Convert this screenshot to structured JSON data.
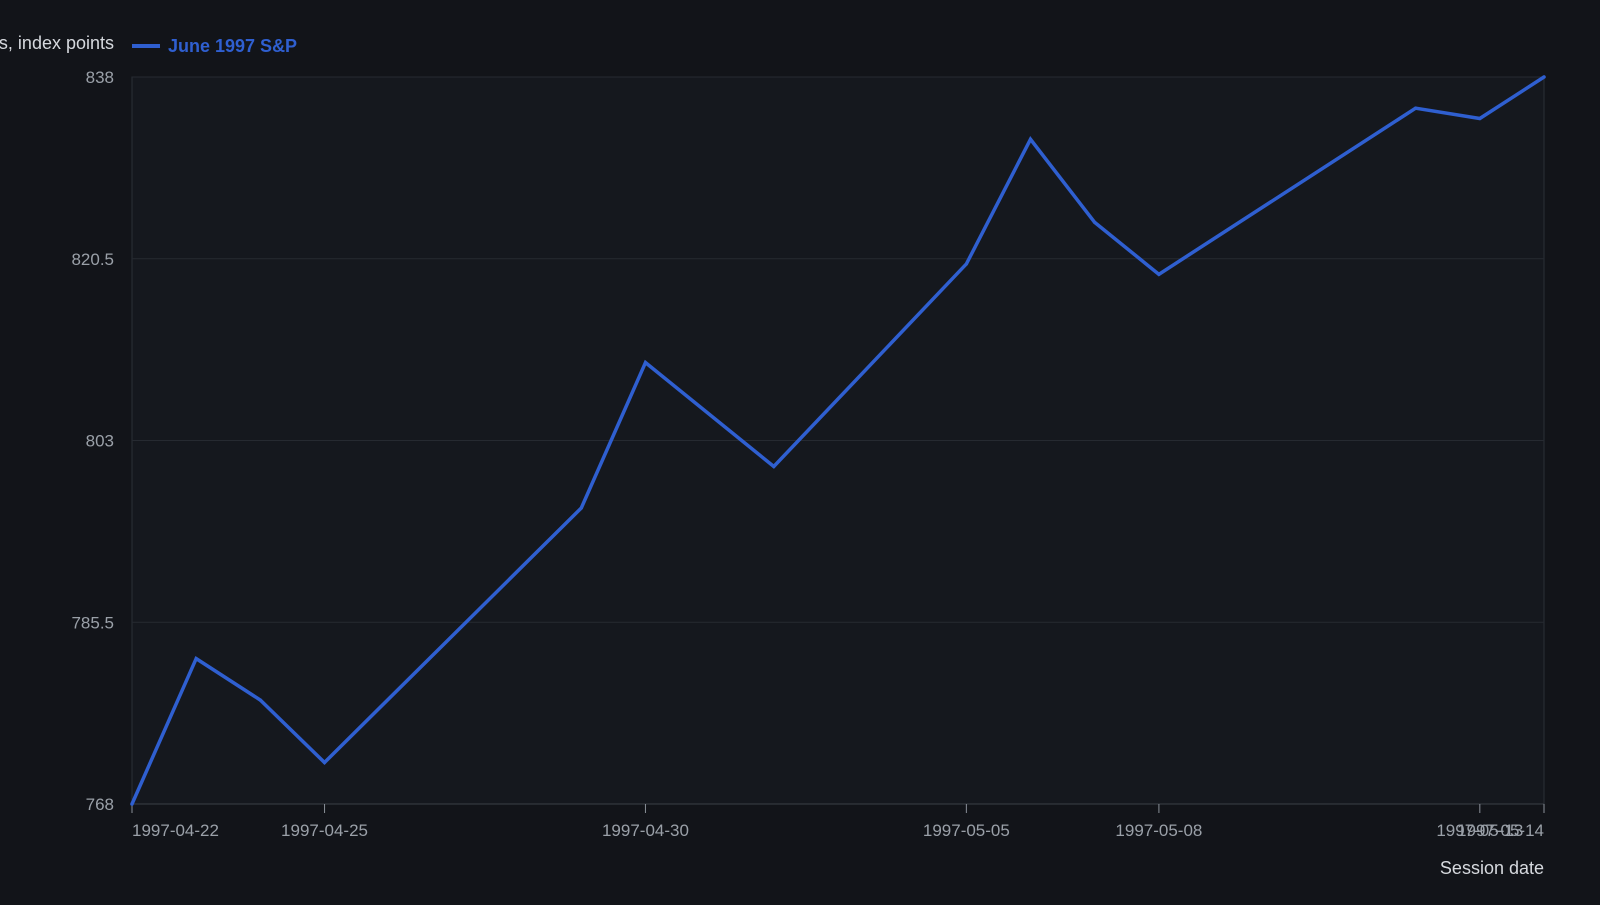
{
  "chart_data": {
    "type": "line",
    "ylabel": "Points, index points",
    "xlabel": "Session date",
    "ylim": [
      768,
      838
    ],
    "yticks": [
      768,
      785.5,
      803,
      820.5,
      838
    ],
    "ytick_labels": [
      "768",
      "785.5",
      "803",
      "820.5",
      "838"
    ],
    "xticks": [
      "1997-04-22",
      "1997-04-25",
      "1997-04-30",
      "1997-05-05",
      "1997-05-08",
      "1997-05-13",
      "1997-05-14"
    ],
    "grid": true,
    "legend_position": "top-left",
    "series": [
      {
        "name": "June 1997 S&P",
        "color": "#2f5fd0",
        "x": [
          "1997-04-22",
          "1997-04-23",
          "1997-04-24",
          "1997-04-25",
          "1997-04-29",
          "1997-04-30",
          "1997-05-02",
          "1997-05-05",
          "1997-05-06",
          "1997-05-07",
          "1997-05-08",
          "1997-05-12",
          "1997-05-13",
          "1997-05-14"
        ],
        "y": [
          768,
          782,
          778,
          772,
          796.5,
          810.5,
          800.5,
          820,
          832,
          824,
          819,
          835,
          834,
          838
        ]
      }
    ]
  }
}
